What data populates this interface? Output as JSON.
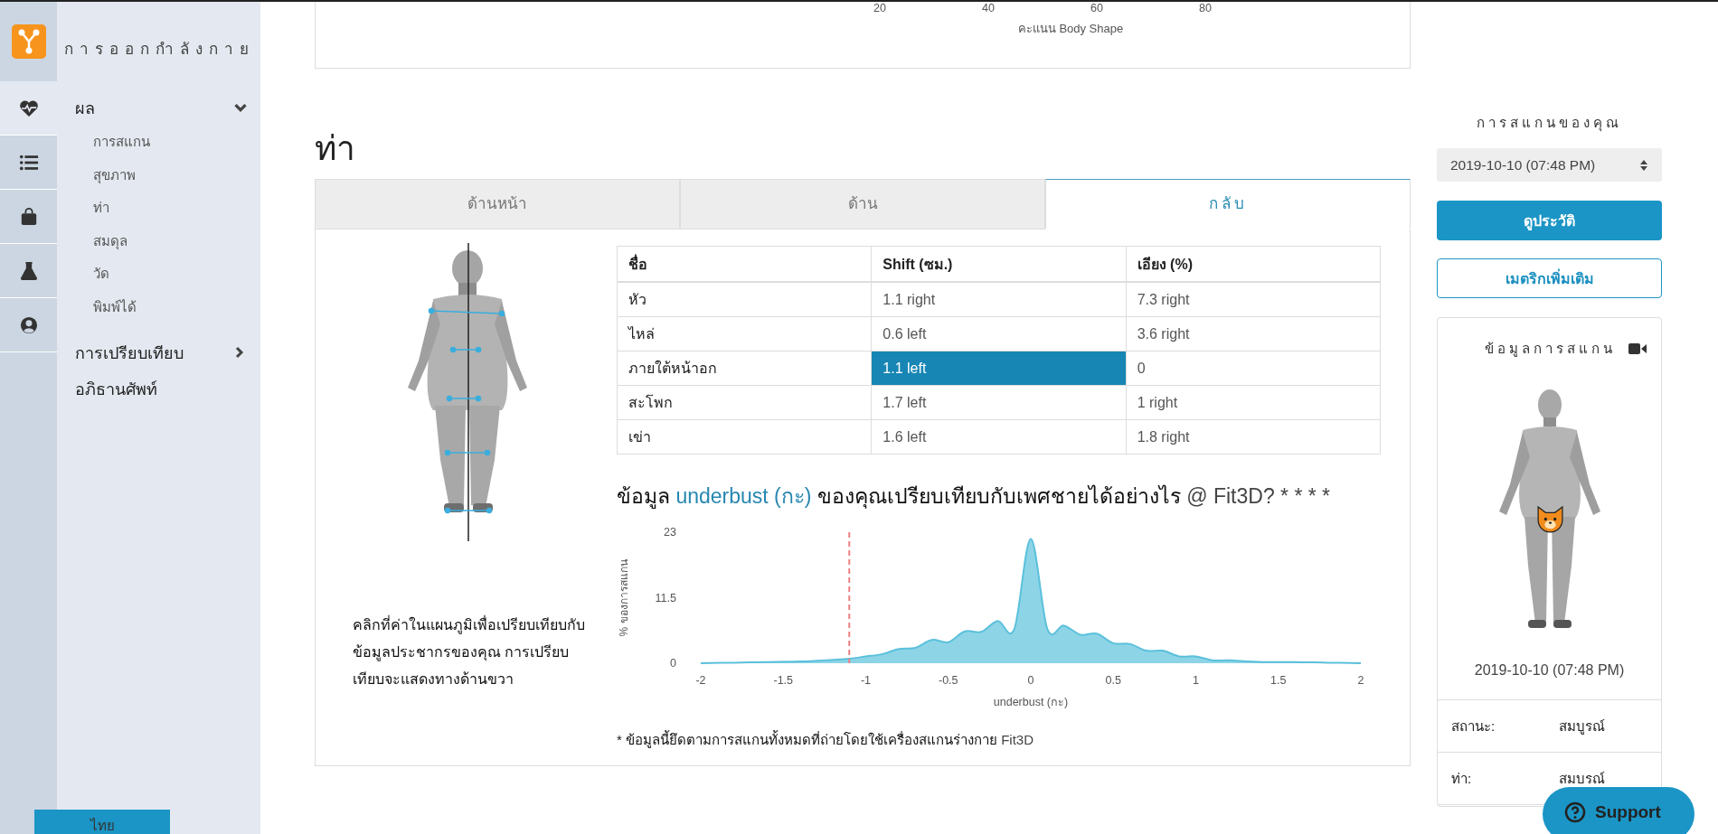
{
  "app": {
    "title": "การออกกำลังกาย",
    "language_button": "ไทย"
  },
  "rail": [
    {
      "kind": "heart",
      "selected": true
    },
    {
      "kind": "list",
      "selected": false
    },
    {
      "kind": "bag",
      "selected": false
    },
    {
      "kind": "flask",
      "selected": false
    },
    {
      "kind": "user",
      "selected": false
    }
  ],
  "nav": [
    {
      "label": "ผล",
      "expanded": true,
      "children": [
        {
          "label": "การสแกน"
        },
        {
          "label": "สุขภาพ"
        },
        {
          "label": "ท่า"
        },
        {
          "label": "สมดุล"
        },
        {
          "label": "วัด"
        },
        {
          "label": "พิมพ์ได้"
        }
      ]
    },
    {
      "label": "การเปรียบเทียบ",
      "expanded": false
    },
    {
      "label": "อภิธานศัพท์"
    }
  ],
  "top_chart": {
    "ticks": [
      "20",
      "40",
      "60",
      "80"
    ],
    "axis_label": "คะแนน Body Shape"
  },
  "section_title": "ท่า",
  "tabs": [
    {
      "label": "ด้านหน้า",
      "selected": false
    },
    {
      "label": "ด้าน",
      "selected": false
    },
    {
      "label": "กลับ",
      "selected": true
    }
  ],
  "hint": "คลิกที่ค่าในแผนภูมิเพื่อเปรียบเทียบกับข้อมูลประชากรของคุณ การเปรียบเทียบจะแสดงทางด้านขวา",
  "table": {
    "columns": [
      "ชื่อ",
      "Shift (ซม.)",
      "เอียง (%)"
    ],
    "rows": [
      {
        "cells": [
          {
            "text": "หัว",
            "selected": false
          },
          {
            "text": "1.1 right",
            "selected": false
          },
          {
            "text": "7.3 right",
            "selected": false
          }
        ]
      },
      {
        "cells": [
          {
            "text": "ไหล่",
            "selected": false
          },
          {
            "text": "0.6 left",
            "selected": false
          },
          {
            "text": "3.6 right",
            "selected": false
          }
        ]
      },
      {
        "cells": [
          {
            "text": "ภายใต้หน้าอก",
            "selected": false
          },
          {
            "text": "1.1 left",
            "selected": true
          },
          {
            "text": "0",
            "selected": false
          }
        ]
      },
      {
        "cells": [
          {
            "text": "สะโพก",
            "selected": false
          },
          {
            "text": "1.7 left",
            "selected": false
          },
          {
            "text": "1 right",
            "selected": false
          }
        ]
      },
      {
        "cells": [
          {
            "text": "เข่า",
            "selected": false
          },
          {
            "text": "1.6 left",
            "selected": false
          },
          {
            "text": "1.8 right",
            "selected": false
          }
        ]
      }
    ]
  },
  "chart_title": [
    {
      "text": "ข้อมูล ",
      "kind": "plain"
    },
    {
      "text": "underbust (กะ)",
      "kind": "metric"
    },
    {
      "text": " ของคุณเปรียบเทียบกับเพศชายได้อย่างไร",
      "kind": "plain"
    },
    {
      "text": " @ Fit3D? * * * *",
      "kind": "light"
    }
  ],
  "chart_data": {
    "type": "area",
    "xlabel": "underbust (กะ)",
    "ylabel": "% ของการสแกน",
    "x": [
      -2,
      -1.8,
      -1.6,
      -1.4,
      -1.2,
      -1.1,
      -1,
      -0.9,
      -0.8,
      -0.7,
      -0.6,
      -0.5,
      -0.4,
      -0.3,
      -0.2,
      -0.1,
      0,
      0.1,
      0.2,
      0.3,
      0.4,
      0.5,
      0.6,
      0.7,
      0.8,
      0.9,
      1,
      1.1,
      1.2,
      1.4,
      1.6,
      1.8,
      2
    ],
    "series": [
      {
        "color": "#8dd5e6",
        "values": [
          0,
          0.1,
          0.2,
          0.3,
          0.6,
          0.8,
          1.2,
          1.6,
          2.5,
          2.7,
          4.1,
          3.7,
          5.6,
          5.5,
          7.4,
          6,
          21.8,
          6,
          6.6,
          5,
          5.2,
          3.5,
          3.4,
          2.2,
          2.2,
          1.2,
          1.2,
          0.5,
          0.5,
          0.2,
          0.2,
          0.1,
          0
        ]
      }
    ],
    "xlim": [
      -2,
      2
    ],
    "ylim": [
      0,
      23
    ],
    "xticks": [
      -2,
      -1.5,
      -1,
      -0.5,
      0,
      0.5,
      1,
      1.5,
      2
    ],
    "yticks": [
      0,
      11.5,
      23
    ],
    "ref_lines": [
      {
        "axis": "x",
        "value": -1.1,
        "color": "#f08080"
      }
    ]
  },
  "footnote": [
    {
      "text": "* ข้อมูลนี้ยึดตามการสแกนทั้งหมดที่ถ่ายโดยใช้เครื่องสแกนร่างกาย ",
      "kind": "plain"
    },
    {
      "text": "Fit3D",
      "kind": "light"
    }
  ],
  "panel": {
    "title": "การสแกนของคุณ",
    "scan_select": "2019-10-10 (07:48 PM)",
    "history_button": "ดูประวัติ",
    "metrics_button": "เมตริกเพิ่มเติม",
    "card": {
      "title": "ข้อมูลการสแกน",
      "date": "2019-10-10 (07:48 PM)",
      "rows": [
        {
          "label": "สถานะ:",
          "value": "สมบูรณ์"
        },
        {
          "label": "ท่า:",
          "value": "สมบรณ์"
        }
      ]
    }
  },
  "support_button": "Support"
}
